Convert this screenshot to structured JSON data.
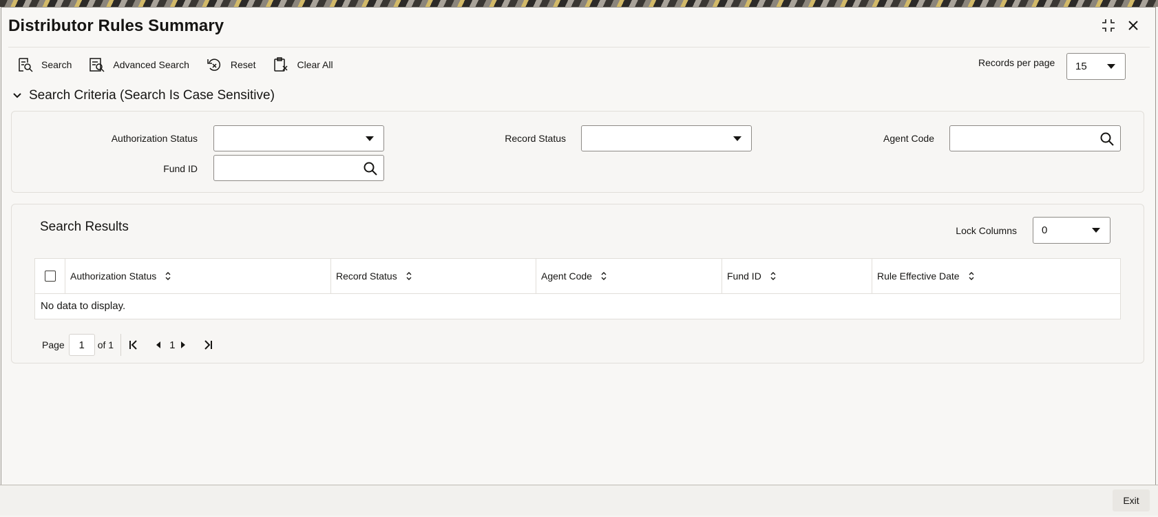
{
  "window": {
    "title": "Distributor Rules Summary"
  },
  "toolbar": {
    "search_label": "Search",
    "advanced_search_label": "Advanced Search",
    "reset_label": "Reset",
    "clear_all_label": "Clear All",
    "records_per_page_label": "Records per page",
    "records_per_page_value": "15"
  },
  "criteria": {
    "header": "Search Criteria (Search Is Case Sensitive)",
    "authorization_status_label": "Authorization Status",
    "authorization_status_value": "",
    "record_status_label": "Record Status",
    "record_status_value": "",
    "agent_code_label": "Agent Code",
    "agent_code_value": "",
    "fund_id_label": "Fund ID",
    "fund_id_value": ""
  },
  "results": {
    "title": "Search Results",
    "lock_columns_label": "Lock Columns",
    "lock_columns_value": "0",
    "columns": [
      "Authorization Status",
      "Record Status",
      "Agent Code",
      "Fund ID",
      "Rule Effective Date"
    ],
    "empty_message": "No data to display."
  },
  "pager": {
    "page_label": "Page",
    "current_page": "1",
    "of_label": "of 1",
    "page_number": "1"
  },
  "footer": {
    "exit_label": "Exit"
  },
  "icons": {
    "maximize": "maximize-icon",
    "close": "close-icon",
    "search": "search-icon",
    "advanced_search": "advanced-search-icon",
    "reset": "reset-icon",
    "clear_all": "clear-all-icon",
    "collapse": "chevron-down-icon",
    "lookup": "magnifier-icon",
    "sort": "sort-icon",
    "first_page": "first-page-icon",
    "prev_page": "prev-page-icon",
    "next_page": "next-page-icon",
    "last_page": "last-page-icon"
  }
}
